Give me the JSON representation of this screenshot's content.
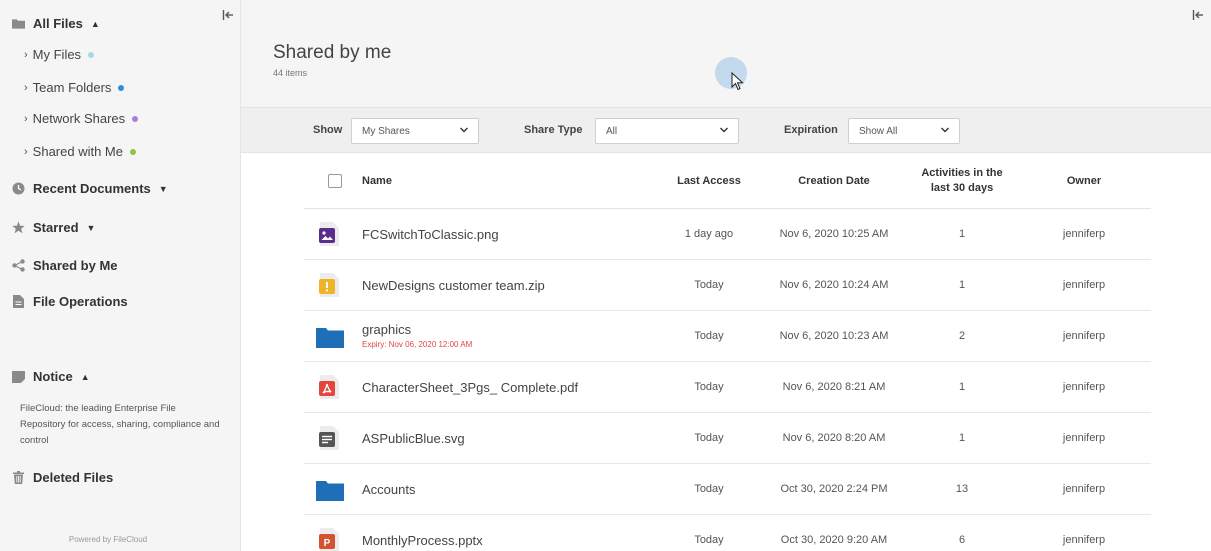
{
  "sidebar": {
    "all_files": "All Files",
    "sub_items": [
      {
        "label": "My Files",
        "dot_color": "#a6d8ea"
      },
      {
        "label": "Team Folders",
        "dot_color": "#2d8fdd"
      },
      {
        "label": "Network Shares",
        "dot_color": "#a880e0"
      },
      {
        "label": "Shared with Me",
        "dot_color": "#8cc63f"
      }
    ],
    "recent_documents": "Recent Documents",
    "starred": "Starred",
    "shared_by_me": "Shared by Me",
    "file_operations": "File Operations",
    "notice": "Notice",
    "notice_text": "FileCloud: the leading Enterprise File Repository for access, sharing, compliance and control",
    "deleted_files": "Deleted Files",
    "powered_by": "Powered by FileCloud"
  },
  "header": {
    "title": "Shared by me",
    "item_count": "44 items"
  },
  "filters": {
    "show_label": "Show",
    "show_value": "My Shares",
    "share_type_label": "Share Type",
    "share_type_value": "All",
    "expiration_label": "Expiration",
    "expiration_value": "Show All"
  },
  "table": {
    "columns": {
      "name": "Name",
      "last_access": "Last Access",
      "creation_date": "Creation Date",
      "activities_line1": "Activities in the",
      "activities_line2": "last 30 days",
      "owner": "Owner"
    },
    "rows": [
      {
        "name": "FCSwitchToClassic.png",
        "icon": "image-file-icon",
        "expiry": "",
        "last_access": "1 day ago",
        "creation_date": "Nov 6, 2020 10:25 AM",
        "activities": "1",
        "owner": "jenniferp"
      },
      {
        "name": "NewDesigns customer team.zip",
        "icon": "zip-file-icon",
        "expiry": "",
        "last_access": "Today",
        "creation_date": "Nov 6, 2020 10:24 AM",
        "activities": "1",
        "owner": "jenniferp"
      },
      {
        "name": "graphics",
        "icon": "folder-icon",
        "expiry": "Expiry: Nov 06, 2020 12:00 AM",
        "last_access": "Today",
        "creation_date": "Nov 6, 2020 10:23 AM",
        "activities": "2",
        "owner": "jenniferp"
      },
      {
        "name": "CharacterSheet_3Pgs_ Complete.pdf",
        "icon": "pdf-file-icon",
        "expiry": "",
        "last_access": "Today",
        "creation_date": "Nov 6, 2020 8:21 AM",
        "activities": "1",
        "owner": "jenniferp"
      },
      {
        "name": "ASPublicBlue.svg",
        "icon": "document-file-icon",
        "expiry": "",
        "last_access": "Today",
        "creation_date": "Nov 6, 2020 8:20 AM",
        "activities": "1",
        "owner": "jenniferp"
      },
      {
        "name": "Accounts",
        "icon": "folder-icon",
        "expiry": "",
        "last_access": "Today",
        "creation_date": "Oct 30, 2020 2:24 PM",
        "activities": "13",
        "owner": "jenniferp"
      },
      {
        "name": "MonthlyProcess.pptx",
        "icon": "powerpoint-file-icon",
        "expiry": "",
        "last_access": "Today",
        "creation_date": "Oct 30, 2020 9:20 AM",
        "activities": "6",
        "owner": "jenniferp"
      }
    ]
  },
  "colors": {
    "image_icon": "#5a2d8c",
    "zip_icon": "#f0b429",
    "folder_icon": "#1f6fb8",
    "pdf_icon": "#e4463b",
    "doc_icon": "#555555",
    "ppt_icon": "#d35230",
    "expiry_text": "#e04545"
  }
}
